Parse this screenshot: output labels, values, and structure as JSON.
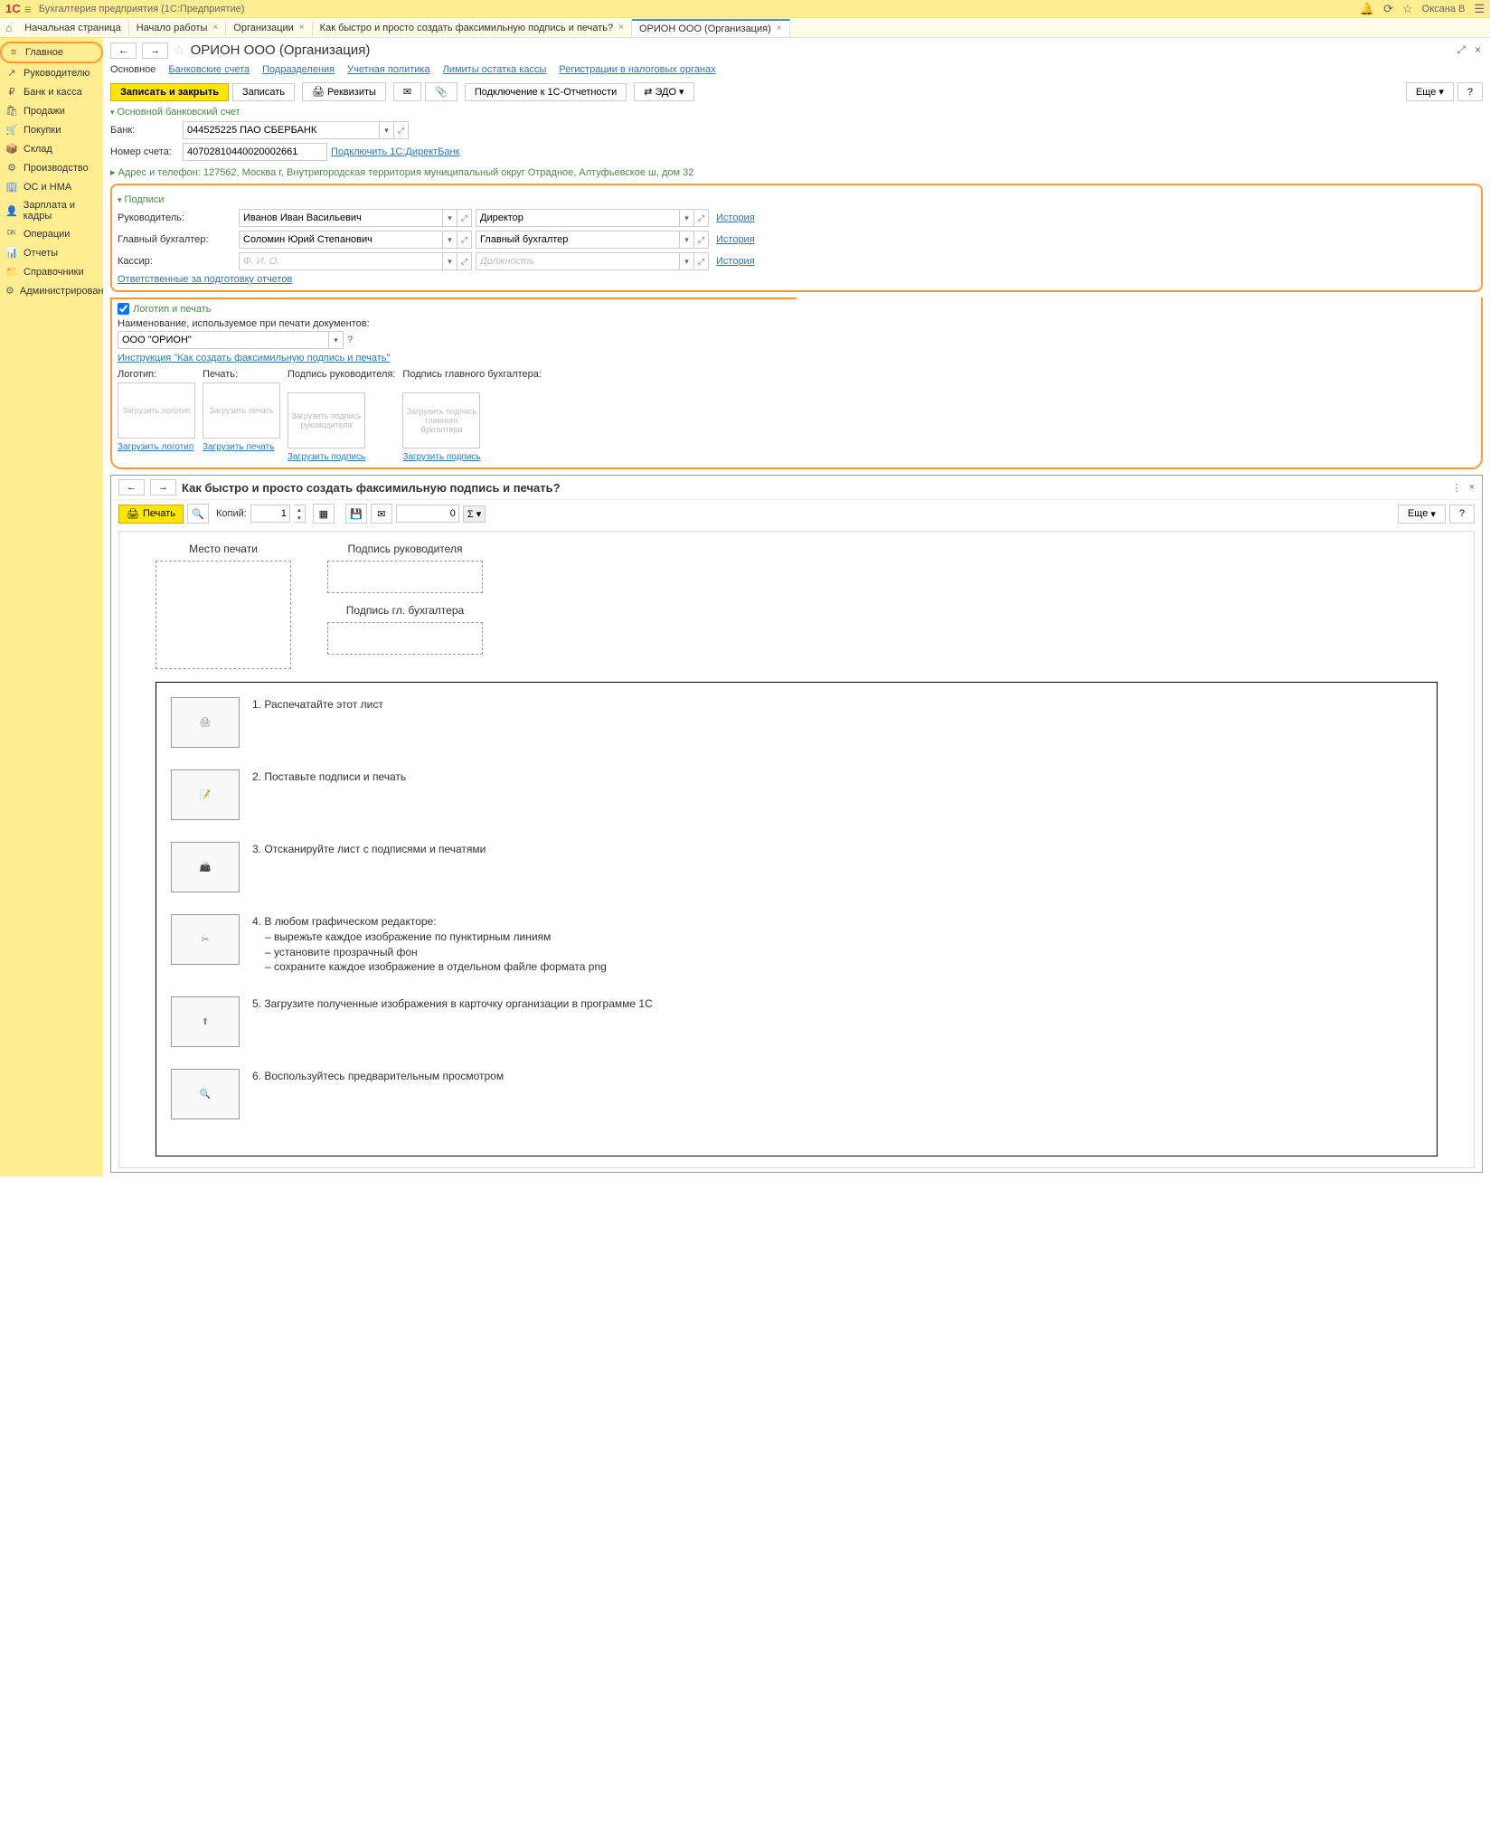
{
  "titlebar": {
    "app_title": "Бухгалтерия предприятия  (1С:Предприятие)",
    "user": "Оксана В"
  },
  "tabs": [
    {
      "label": "Начальная страница",
      "closable": false
    },
    {
      "label": "Начало работы",
      "closable": true
    },
    {
      "label": "Организации",
      "closable": true
    },
    {
      "label": "Как быстро и просто создать факсимильную подпись и печать?",
      "closable": true
    },
    {
      "label": "ОРИОН ООО (Организация)",
      "closable": true,
      "active": true
    }
  ],
  "sidebar": [
    {
      "icon": "≡",
      "label": "Главное",
      "highlighted": true
    },
    {
      "icon": "↗",
      "label": "Руководителю"
    },
    {
      "icon": "₽",
      "label": "Банк и касса"
    },
    {
      "icon": "🛍",
      "label": "Продажи"
    },
    {
      "icon": "🛒",
      "label": "Покупки"
    },
    {
      "icon": "📦",
      "label": "Склад"
    },
    {
      "icon": "⚙",
      "label": "Производство"
    },
    {
      "icon": "🏢",
      "label": "ОС и НМА"
    },
    {
      "icon": "👤",
      "label": "Зарплата и кадры"
    },
    {
      "icon": "ᴰᴷ",
      "label": "Операции"
    },
    {
      "icon": "📊",
      "label": "Отчеты"
    },
    {
      "icon": "📁",
      "label": "Справочники"
    },
    {
      "icon": "⚙",
      "label": "Администрирование"
    }
  ],
  "page": {
    "title": "ОРИОН ООО (Организация)",
    "subtabs": [
      {
        "label": "Основное",
        "active": true
      },
      {
        "label": "Банковские счета"
      },
      {
        "label": "Подразделения"
      },
      {
        "label": "Учетная политика"
      },
      {
        "label": "Лимиты остатка кассы"
      },
      {
        "label": "Регистрации в налоговых органах"
      }
    ]
  },
  "toolbar": {
    "save_close": "Записать и закрыть",
    "save": "Записать",
    "details": "Реквизиты",
    "connect": "Подключение к 1С-Отчетности",
    "edo": "ЭДО",
    "more": "Еще"
  },
  "bank_section": {
    "title": "Основной банковский счет",
    "bank_label": "Банк:",
    "bank_value": "044525225 ПАО СБЕРБАНК",
    "account_label": "Номер счета:",
    "account_value": "40702810440020002661",
    "direct_bank": "Подключить 1С:ДиректБанк"
  },
  "address": "Адрес и телефон: 127562, Москва г, Внутригородская территория муниципальный округ Отрадное, Алтуфьевское ш, дом 32",
  "signatures": {
    "title": "Подписи",
    "rows": [
      {
        "label": "Руководитель:",
        "name": "Иванов Иван Васильевич",
        "position": "Директор",
        "history": "История"
      },
      {
        "label": "Главный бухгалтер:",
        "name": "Соломин Юрий Степанович",
        "position": "Главный бухгалтер",
        "history": "История"
      },
      {
        "label": "Кассир:",
        "name": "",
        "name_ph": "Ф. И. О.",
        "position": "",
        "position_ph": "Должность",
        "history": "История"
      }
    ],
    "responsible": "Ответственные за подготовку отчетов"
  },
  "logo": {
    "title": "Логотип и печать",
    "name_label": "Наименование, используемое при печати документов:",
    "name_value": "ООО \"ОРИОН\"",
    "instruction": "Инструкция \"Как создать факсимильную подпись и печать\"",
    "uploads": [
      {
        "title": "Логотип:",
        "box": "Загрузить логотип",
        "link": "Загрузить логотип"
      },
      {
        "title": "Печать:",
        "box": "Загрузить печать",
        "link": "Загрузить печать"
      },
      {
        "title": "Подпись руководителя:",
        "box": "Загрузить подпись руководителя",
        "link": "Загрузить подпись"
      },
      {
        "title": "Подпись главного бухгалтера:",
        "box": "Загрузить подпись главного бухгалтера",
        "link": "Загрузить подпись"
      }
    ]
  },
  "popup": {
    "title": "Как быстро и просто создать факсимильную подпись и печать?",
    "print": "Печать",
    "copies_label": "Копий:",
    "copies": "1",
    "sum": "0",
    "more": "Еще",
    "preview": {
      "place": "Место печати",
      "sign_head": "Подпись руководителя",
      "sign_acc": "Подпись гл. бухгалтера"
    },
    "steps": [
      {
        "num": "1.",
        "text": "Распечатайте этот лист"
      },
      {
        "num": "2.",
        "text": "Поставьте подписи и печать"
      },
      {
        "num": "3.",
        "text": "Отсканируйте лист с подписями и печатями"
      },
      {
        "num": "4.",
        "text": "В любом графическом редакторе:",
        "sub": [
          "– вырежьте каждое изображение по пунктирным линиям",
          "– установите прозрачный фон",
          "– сохраните каждое изображение в отдельном файле формата png"
        ]
      },
      {
        "num": "5.",
        "text": "Загрузите полученные изображения в карточку организации в программе 1С"
      },
      {
        "num": "6.",
        "text": "Воспользуйтесь предварительным просмотром"
      }
    ]
  }
}
